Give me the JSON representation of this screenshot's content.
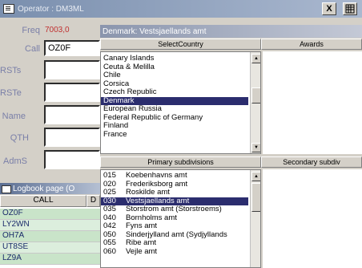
{
  "window": {
    "title": "Operator : DM3ML",
    "close_label": "X"
  },
  "fields": {
    "freq_label": "Freq",
    "freq_value": "7003,0",
    "call_label": "Call",
    "call_value": "OZ0F",
    "rsts_label": "RSTs",
    "rste_label": "RSTe",
    "name_label": "Name",
    "qth_label": "QTH",
    "adms_label": "AdmS"
  },
  "logbook": {
    "title": "Logbook page (O",
    "col_call": "CALL",
    "col_d": "D",
    "rows": [
      "OZ0F",
      "LY2WN",
      "OH7A",
      "UT8SE",
      "LZ9A"
    ]
  },
  "selector": {
    "title": "Denmark: Vestsjaellands amt",
    "col_country": "SelectCountry",
    "col_awards": "Awards",
    "countries": [
      "Canary Islands",
      "Ceuta & Melilla",
      "Chile",
      "Corsica",
      "Czech Republic",
      "Denmark",
      "European Russia",
      "Federal Republic of Germany",
      "Finland",
      "France"
    ],
    "selected_country": "Denmark",
    "col_primary": "Primary subdivisions",
    "col_secondary": "Secondary subdiv",
    "subdivisions": [
      {
        "code": "015",
        "name": "Koebenhavns amt"
      },
      {
        "code": "020",
        "name": "Frederiksborg amt"
      },
      {
        "code": "025",
        "name": "Roskilde amt"
      },
      {
        "code": "030",
        "name": "Vestsjaellands amt"
      },
      {
        "code": "035",
        "name": "Storstrom amt (Storstroems)"
      },
      {
        "code": "040",
        "name": "Bornholms amt"
      },
      {
        "code": "042",
        "name": "Fyns amt"
      },
      {
        "code": "050",
        "name": "Sinderjylland amt (Sydjyllands"
      },
      {
        "code": "055",
        "name": "Ribe amt"
      },
      {
        "code": "060",
        "name": "Vejle amt"
      }
    ],
    "selected_subdivision": "030"
  }
}
